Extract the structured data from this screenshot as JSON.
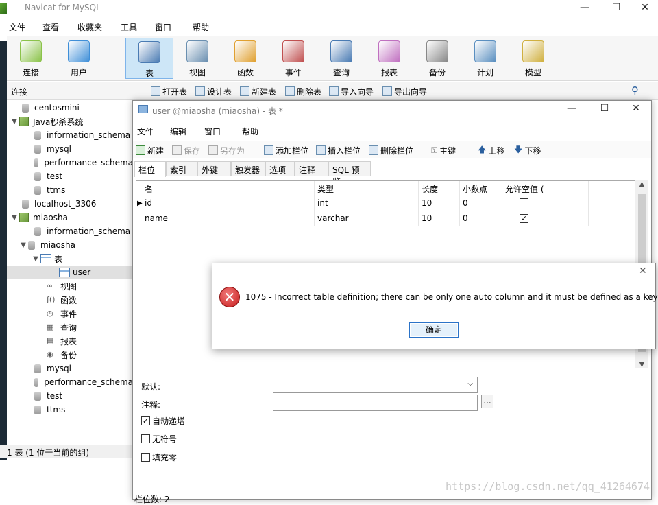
{
  "app": {
    "title": "Navicat for MySQL",
    "min": "—",
    "max": "☐",
    "close": "✕"
  },
  "menu": [
    "文件",
    "查看",
    "收藏夹",
    "工具",
    "窗口",
    "帮助"
  ],
  "toolbar": [
    {
      "label": "连接",
      "icon": "plug-icon"
    },
    {
      "label": "用户",
      "icon": "user-icon"
    },
    {
      "label": "表",
      "icon": "table-icon",
      "active": true
    },
    {
      "label": "视图",
      "icon": "view-icon"
    },
    {
      "label": "函数",
      "icon": "function-icon"
    },
    {
      "label": "事件",
      "icon": "event-icon"
    },
    {
      "label": "查询",
      "icon": "query-icon"
    },
    {
      "label": "报表",
      "icon": "report-icon"
    },
    {
      "label": "备份",
      "icon": "backup-icon"
    },
    {
      "label": "计划",
      "icon": "schedule-icon"
    },
    {
      "label": "模型",
      "icon": "model-icon"
    }
  ],
  "subbar": {
    "section": "连接",
    "open": "打开表",
    "design": "设计表",
    "new": "新建表",
    "delete": "删除表",
    "import": "导入向导",
    "export": "导出向导"
  },
  "tree": [
    {
      "label": "centosmini",
      "indent": 1,
      "type": "db"
    },
    {
      "label": "Java秒杀系统",
      "indent": 0,
      "type": "server",
      "arrow": "▼"
    },
    {
      "label": "information_schema",
      "indent": 2,
      "type": "db"
    },
    {
      "label": "mysql",
      "indent": 2,
      "type": "db"
    },
    {
      "label": "performance_schema",
      "indent": 2,
      "type": "db"
    },
    {
      "label": "test",
      "indent": 2,
      "type": "db"
    },
    {
      "label": "ttms",
      "indent": 2,
      "type": "db"
    },
    {
      "label": "localhost_3306",
      "indent": 1,
      "type": "db"
    },
    {
      "label": "miaosha",
      "indent": 0,
      "type": "server",
      "arrow": "▼"
    },
    {
      "label": "information_schema",
      "indent": 2,
      "type": "db"
    },
    {
      "label": "miaosha",
      "indent": 1.5,
      "type": "db",
      "arrow": "▼"
    },
    {
      "label": "表",
      "indent": 2.5,
      "type": "table",
      "arrow": "▼"
    },
    {
      "label": "user",
      "indent": 4,
      "type": "table",
      "selected": true
    },
    {
      "label": "视图",
      "indent": 3,
      "type": "small",
      "glyph": "∞"
    },
    {
      "label": "函数",
      "indent": 3,
      "type": "small",
      "glyph": "ƒ()"
    },
    {
      "label": "事件",
      "indent": 3,
      "type": "small",
      "glyph": "◷"
    },
    {
      "label": "查询",
      "indent": 3,
      "type": "small",
      "glyph": "▦"
    },
    {
      "label": "报表",
      "indent": 3,
      "type": "small",
      "glyph": "▤"
    },
    {
      "label": "备份",
      "indent": 3,
      "type": "small",
      "glyph": "◉"
    },
    {
      "label": "mysql",
      "indent": 2,
      "type": "db"
    },
    {
      "label": "performance_schema",
      "indent": 2,
      "type": "db"
    },
    {
      "label": "test",
      "indent": 2,
      "type": "db"
    },
    {
      "label": "ttms",
      "indent": 2,
      "type": "db"
    }
  ],
  "status": "1 表 (1 位于当前的组)",
  "editor": {
    "title": "user @miaosha (miaosha) - 表 *",
    "menu": [
      "文件",
      "编辑",
      "窗口",
      "帮助"
    ],
    "tools": {
      "new": "新建",
      "save": "保存",
      "saveas": "另存为",
      "addcol": "添加栏位",
      "inscol": "插入栏位",
      "delcol": "删除栏位",
      "pk": "主键",
      "up": "上移",
      "down": "下移"
    },
    "tabs": [
      "栏位",
      "索引",
      "外键",
      "触发器",
      "选项",
      "注释",
      "SQL 预览"
    ],
    "columns": [
      "名",
      "类型",
      "长度",
      "小数点",
      "允许空值 ("
    ],
    "rows": [
      {
        "name": "id",
        "type": "int",
        "len": "10",
        "dec": "0",
        "null": false,
        "current": true
      },
      {
        "name": "name",
        "type": "varchar",
        "len": "10",
        "dec": "0",
        "null": true,
        "current": false
      }
    ],
    "props": {
      "default_label": "默认:",
      "comment_label": "注释:",
      "browse": "...",
      "auto_inc": "自动递增",
      "unsigned": "无符号",
      "zerofill": "填充零"
    },
    "footer": "栏位数: 2"
  },
  "dialog": {
    "message": "1075 - Incorrect table definition; there can be only one auto column and it must be defined as a key",
    "ok": "确定",
    "close": "✕"
  },
  "watermark": "https://blog.csdn.net/qq_41264674"
}
